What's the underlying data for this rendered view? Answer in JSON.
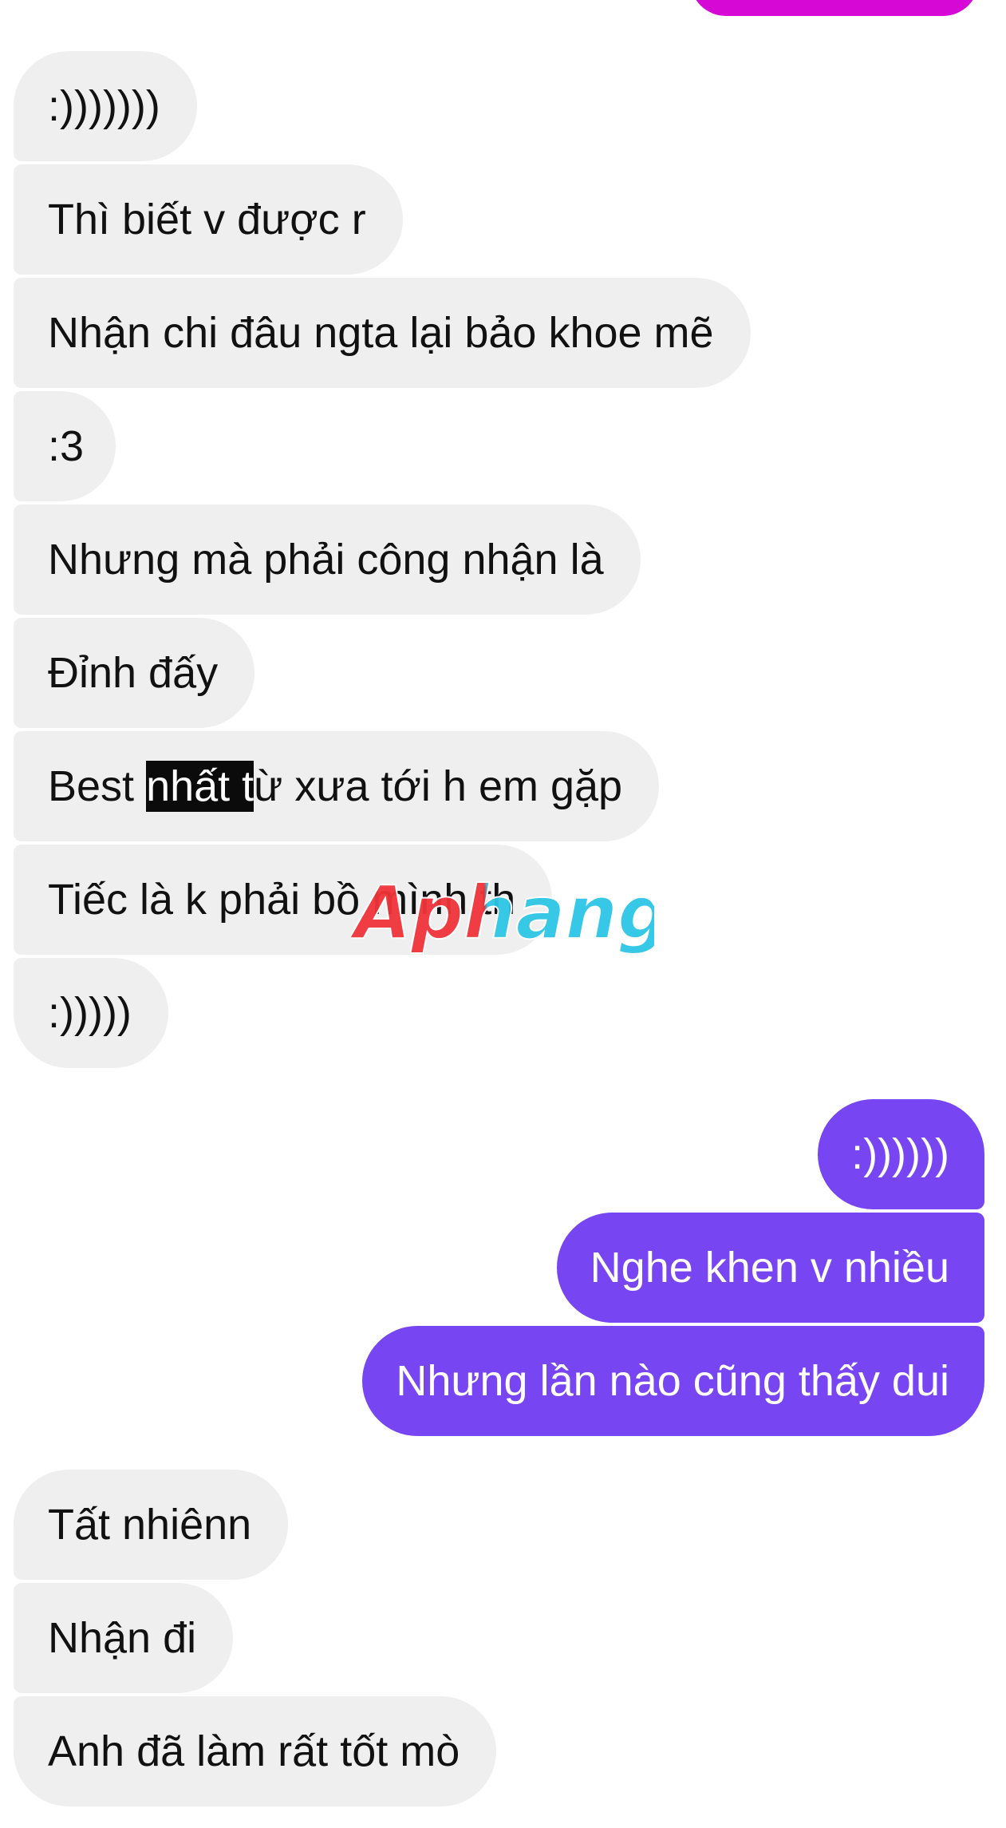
{
  "colors": {
    "incoming_bubble": "#efefef",
    "incoming_text": "#111111",
    "outgoing_bubble": "#7745f2",
    "outgoing_bubble_top": "#d508d5",
    "outgoing_text": "#ffffff",
    "watermark_red": "#f0343a",
    "watermark_cyan": "#2ec6e6"
  },
  "watermark": {
    "text": "Aphang"
  },
  "messages": {
    "incoming_group_1": [
      {
        "text": ":)))))))"
      },
      {
        "text": "Thì biết v được r"
      },
      {
        "text": "Nhận chi đâu ngta lại bảo khoe mẽ"
      },
      {
        "text": ":3"
      },
      {
        "text": "Nhưng mà phải công nhận là"
      },
      {
        "text": "Đỉnh đấy"
      },
      {
        "text_before": "Best ",
        "text_highlight": "nhất t",
        "text_after": "ừ xưa tới h em gặp"
      },
      {
        "text": "Tiếc là k phải bồ mình th"
      },
      {
        "text": ":)))))"
      }
    ],
    "outgoing_group": [
      {
        "text": ":))))))"
      },
      {
        "text": "Nghe khen v nhiều"
      },
      {
        "text": "Nhưng lần nào cũng thấy dui"
      }
    ],
    "incoming_group_2": [
      {
        "text": "Tất nhiênn"
      },
      {
        "text": "Nhận đi"
      },
      {
        "text": "Anh đã làm rất tốt mò"
      }
    ]
  }
}
